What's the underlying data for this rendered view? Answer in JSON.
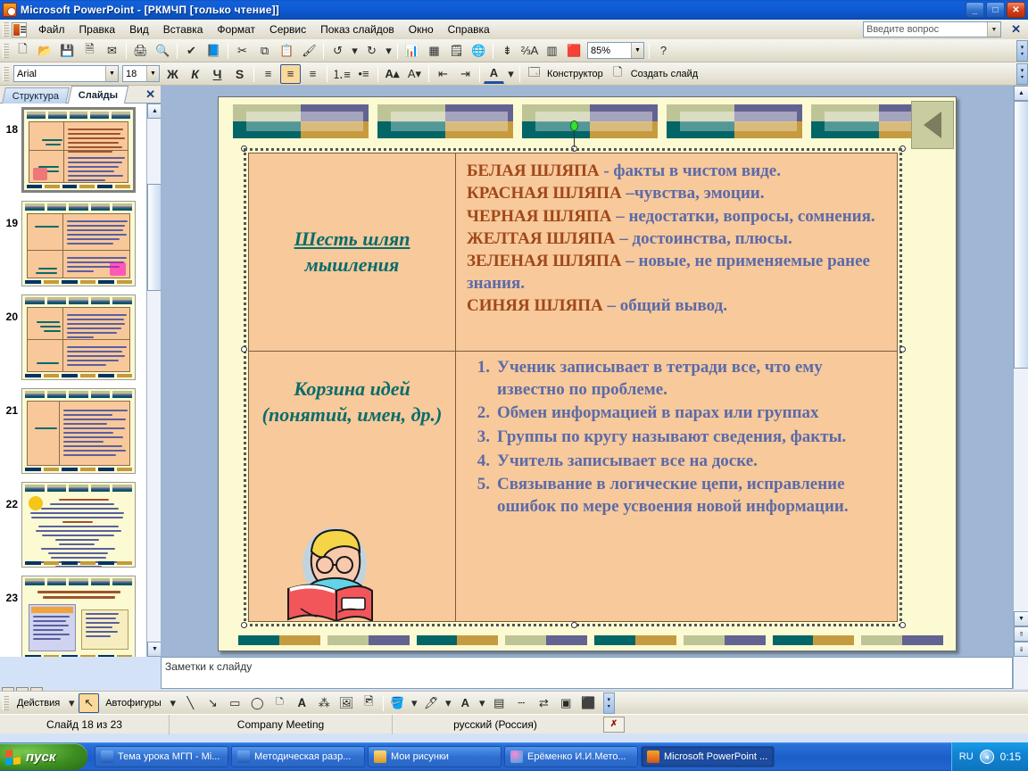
{
  "window": {
    "title": "Microsoft PowerPoint - [РКМЧП [только чтение]]",
    "minimize": "_",
    "maximize": "□",
    "close": "✕"
  },
  "menu": {
    "items": [
      "Файл",
      "Правка",
      "Вид",
      "Вставка",
      "Формат",
      "Сервис",
      "Показ слайдов",
      "Окно",
      "Справка"
    ],
    "ask_placeholder": "Введите вопрос",
    "ask_close": "✕"
  },
  "toolbar_standard": {
    "icons": [
      "new-icon",
      "open-icon",
      "save-icon",
      "permission-icon",
      "email-icon",
      "print-icon",
      "print-preview-icon",
      "spelling-icon",
      "research-icon",
      "cut-icon",
      "copy-icon",
      "paste-icon",
      "format-painter-icon",
      "undo-icon",
      "redo-icon",
      "chart-icon",
      "table-icon",
      "insert-table-icon",
      "hyperlink-icon",
      "expand-icon",
      "animation-icon",
      "grid-icon",
      "colors-icon"
    ],
    "zoom_value": "85%",
    "help": "?"
  },
  "toolbar_formatting": {
    "font_name": "Arial",
    "font_size": "18",
    "bold": "Ж",
    "italic": "К",
    "underline": "Ч",
    "shadow": "S",
    "align_left": "align-left-icon",
    "align_center": "align-center-icon",
    "align_right": "align-right-icon",
    "numbering": "numbering-icon",
    "bullets": "bullets-icon",
    "increase_font": "A",
    "decrease_font": "A",
    "decrease_indent": "decrease-indent-icon",
    "increase_indent": "increase-indent-icon",
    "font_color": "A",
    "designer_label": "Конструктор",
    "new_slide_label": "Создать слайд"
  },
  "left_pane": {
    "tab_outline": "Структура",
    "tab_slides": "Слайды",
    "close": "✕",
    "thumbnails": [
      {
        "number": "18",
        "selected": true
      },
      {
        "number": "19",
        "selected": false
      },
      {
        "number": "20",
        "selected": false
      },
      {
        "number": "21",
        "selected": false
      },
      {
        "number": "22",
        "selected": false
      },
      {
        "number": "23",
        "selected": false
      }
    ]
  },
  "slide": {
    "rows": [
      {
        "heading_lines": [
          "Шесть шляп",
          "мышления"
        ],
        "lines": [
          {
            "term": "БЕЛАЯ ШЛЯПА",
            "rest": " - факты в чистом виде."
          },
          {
            "term": "КРАСНАЯ ШЛЯПА",
            "rest": " –чувства, эмоции."
          },
          {
            "term": "ЧЕРНАЯ ШЛЯПА",
            "rest": " – недостатки, вопросы, сомнения."
          },
          {
            "term": "ЖЕЛТАЯ ШЛЯПА",
            "rest": " – достоинства, плюсы."
          },
          {
            "term": "ЗЕЛЕНАЯ ШЛЯПА",
            "rest": " – новые, не применяемые ранее знания."
          },
          {
            "term": "СИНЯЯ ШЛЯПА",
            "rest": " – общий вывод."
          }
        ]
      },
      {
        "heading_lines": [
          "Корзина идей",
          "(понятий, имен, др.)"
        ],
        "items": [
          "Ученик записывает в тетради все, что ему известно по проблеме.",
          "Обмен информацией в парах или группах",
          "Группы по кругу называют сведения, факты.",
          "Учитель записывает все на доске.",
          "Связывание в логические цепи, исправление ошибок по мере усвоения новой информации."
        ]
      }
    ],
    "clipart": "boy-reading-book-image",
    "colors": {
      "slide_background": "#fbfad2",
      "table_fill": "#f7c99b",
      "heading_text": "#0a6c6a",
      "term_text": "#a0481a",
      "body_text": "#5c6aa8",
      "deco_teal": "#036666",
      "deco_gold": "#c69b3f",
      "deco_sage": "#bfc497",
      "deco_purple": "#626391"
    }
  },
  "notes": {
    "placeholder": "Заметки к слайду"
  },
  "drawing_toolbar": {
    "actions_label": "Действия",
    "autoshapes_label": "Автофигуры",
    "icons": [
      "select-arrow-icon",
      "line-icon",
      "arrow-icon",
      "rectangle-icon",
      "oval-icon",
      "textbox-icon",
      "wordart-icon",
      "diagram-icon",
      "clipart-icon",
      "picture-icon",
      "fill-color-icon",
      "line-color-icon",
      "font-color-icon",
      "line-style-icon",
      "dash-style-icon",
      "arrow-style-icon",
      "shadow-icon",
      "3d-icon"
    ]
  },
  "status_bar": {
    "slide_counter": "Слайд 18 из 23",
    "design_template": "Company Meeting",
    "language": "русский (Россия)",
    "spell_icon": "spelling-status-icon"
  },
  "taskbar": {
    "start_label": "пуск",
    "tasks": [
      {
        "label": "Тема урока МГП - Mi...",
        "icon": "word-icon",
        "active": false
      },
      {
        "label": "Методическая разр...",
        "icon": "word-icon",
        "active": false
      },
      {
        "label": "Мои рисунки",
        "icon": "folder-icon",
        "active": false
      },
      {
        "label": "Ерёменко И.И.Мето...",
        "icon": "app-icon",
        "active": false
      },
      {
        "label": "Microsoft PowerPoint ...",
        "icon": "powerpoint-icon",
        "active": true
      }
    ],
    "tray": {
      "language": "RU",
      "clock": "0:15",
      "icon": "tray-icon"
    }
  }
}
